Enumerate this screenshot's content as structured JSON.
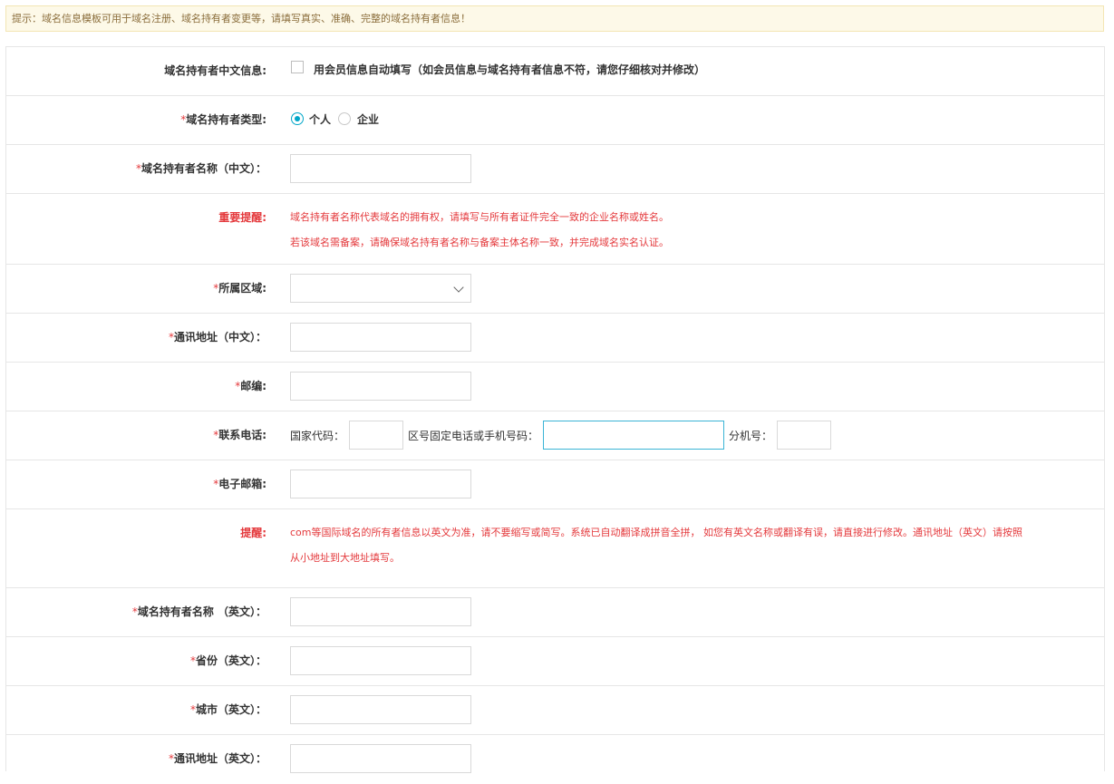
{
  "notice": "提示：域名信息模板可用于域名注册、域名持有者变更等，请填写真实、准确、完整的域名持有者信息！",
  "form": {
    "holder_cn_info": {
      "label": "域名持有者中文信息:",
      "checkbox_label": "用会员信息自动填写（如会员信息与域名持有者信息不符，请您仔细核对并修改）",
      "checked": false
    },
    "holder_type": {
      "required": "*",
      "label": "域名持有者类型:",
      "options": [
        "个人",
        "企业"
      ],
      "selected": "个人"
    },
    "holder_name_cn": {
      "required": "*",
      "label": "域名持有者名称（中文）：",
      "value": ""
    },
    "important_notice": {
      "label": "重要提醒:",
      "lines": [
        "域名持有者名称代表域名的拥有权，请填写与所有者证件完全一致的企业名称或姓名。",
        "若该域名需备案，请确保域名持有者名称与备案主体名称一致，并完成域名实名认证。"
      ]
    },
    "region": {
      "required": "*",
      "label": "所属区域:",
      "value": ""
    },
    "address_cn": {
      "required": "*",
      "label": "通讯地址（中文）：",
      "value": ""
    },
    "postcode": {
      "required": "*",
      "label": "邮编:",
      "value": ""
    },
    "phone": {
      "required": "*",
      "label": "联系电话:",
      "country_code_label": "国家代码：",
      "number_label": "区号固定电话或手机号码：",
      "ext_label": "分机号：",
      "country_code": "",
      "number": "",
      "ext": ""
    },
    "email": {
      "required": "*",
      "label": "电子邮箱:",
      "value": ""
    },
    "reminder": {
      "label": "提醒:",
      "lines": [
        "com等国际域名的所有者信息以英文为准，请不要缩写或简写。系统已自动翻译成拼音全拼， 如您有英文名称或翻译有误，请直接进行修改。通讯地址（英文）请按照",
        "从小地址到大地址填写。"
      ]
    },
    "holder_name_en": {
      "required": "*",
      "label": "域名持有者名称 （英文）：",
      "value": ""
    },
    "province_en": {
      "required": "*",
      "label": "省份（英文）：",
      "value": ""
    },
    "city_en": {
      "required": "*",
      "label": "城市（英文）：",
      "value": ""
    },
    "address_en": {
      "required": "*",
      "label": "通讯地址（英文）：",
      "value": ""
    }
  }
}
